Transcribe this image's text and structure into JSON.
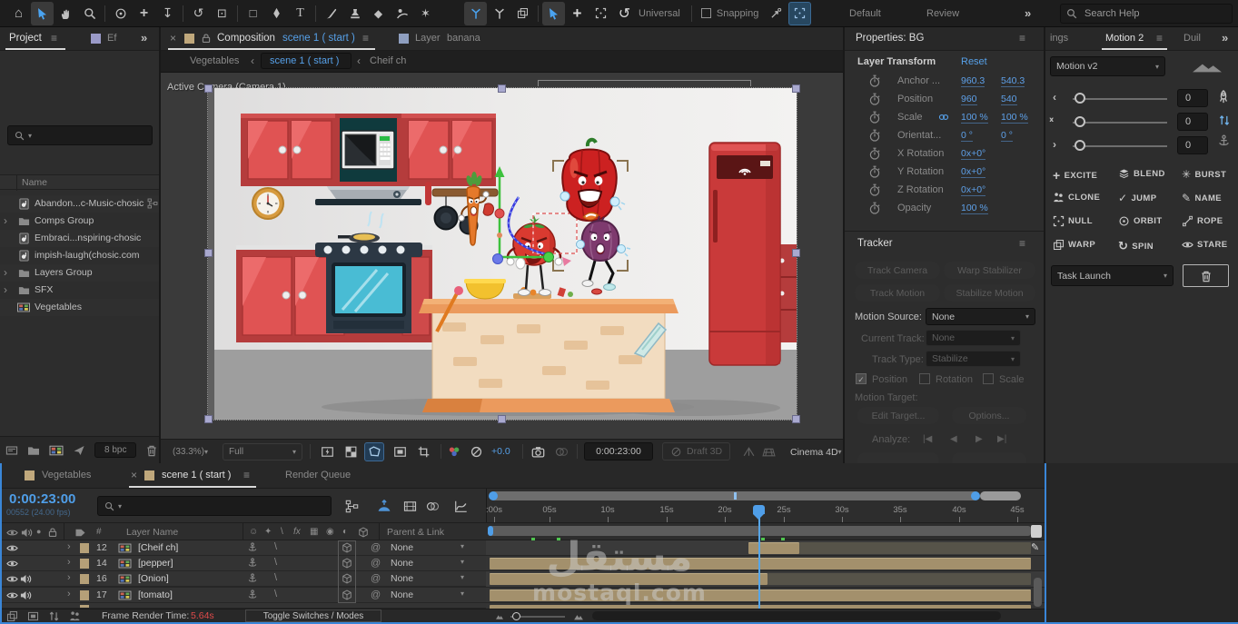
{
  "icons": {
    "hamburger": "≡",
    "more": "»",
    "close": "×",
    "caret": "▾",
    "back": "‹",
    "fwd": "›",
    "home": "⌂",
    "rot_ccw": "↺",
    "rot_cw": "↻",
    "plus": "+",
    "dolly": "↧",
    "text_tool": "T",
    "pen": "✎",
    "eraser": "◆",
    "rect_tool": "□",
    "roi_tool": "⊡",
    "pin": "✶",
    "pickwhip": "@",
    "solo": "●",
    "hash": "#",
    "star": "✦",
    "slash": "\\",
    "fx": "fx",
    "fgrid": "▦",
    "mblur": "◉",
    "adj": "◐",
    "shy": "☺",
    "s_in": "‹",
    "s_mid": "›‹",
    "s_out": "›",
    "t_first": "|◀",
    "t_prev": "◀",
    "t_play": "▶",
    "t_next": "▶|",
    "excite": "+",
    "burst": "✳",
    "jump": "✓",
    "name_pencil": "✎",
    "spin": "↻",
    "orbit": "◉",
    "stare": "◎"
  },
  "topbar": {
    "universal": "Universal",
    "snapping": "Snapping",
    "workspace_default": "Default",
    "workspace_review": "Review",
    "search_placeholder": "Search Help"
  },
  "project": {
    "tab_label": "Project",
    "effects_tab_label": "Ef",
    "name_header": "Name",
    "items": [
      {
        "name": "Abandon...c-Music-chosic",
        "type": "audio"
      },
      {
        "name": "Comps Group",
        "type": "folder"
      },
      {
        "name": "Embraci...nspiring-chosic",
        "type": "audio"
      },
      {
        "name": "impish-laugh(chosic.com",
        "type": "audio"
      },
      {
        "name": "Layers Group",
        "type": "folder"
      },
      {
        "name": "SFX",
        "type": "folder"
      },
      {
        "name": "Vegetables",
        "type": "comp"
      }
    ],
    "bpc_label": "8 bpc"
  },
  "composition": {
    "tab_prefix": "Composition",
    "tab_name": "scene 1 ( start )",
    "layer_tab_prefix": "Layer",
    "layer_tab_name": "banana",
    "crumb_root": "Vegetables",
    "crumb_current": "scene 1 ( start )",
    "crumb_next": "Cheif ch",
    "view_label": "Active Camera (Camera 1)",
    "zoom": "(33.3%)",
    "resolution": "Full",
    "exposure": "+0.0",
    "timecode": "0:00:23:00",
    "draft3d_label": "Draft 3D",
    "renderer": "Cinema 4D"
  },
  "properties": {
    "title": "Properties: BG",
    "transform_title": "Layer Transform",
    "reset": "Reset",
    "rows": [
      {
        "label": "Anchor ...",
        "v1": "960.3",
        "v2": "540.3"
      },
      {
        "label": "Position",
        "v1": "960",
        "v2": "540"
      },
      {
        "label": "Scale",
        "v1": "100 %",
        "v2": "100 %"
      },
      {
        "label": "Orientat...",
        "v1": "0 °",
        "v2": "0 °"
      },
      {
        "label": "X Rotation",
        "v1": "0x+0°",
        "v2": ""
      },
      {
        "label": "Y Rotation",
        "v1": "0x+0°",
        "v2": ""
      },
      {
        "label": "Z Rotation",
        "v1": "0x+0°",
        "v2": ""
      },
      {
        "label": "Opacity",
        "v1": "100 %",
        "v2": ""
      }
    ]
  },
  "tracker": {
    "title": "Tracker",
    "track_camera": "Track Camera",
    "warp_stabilizer": "Warp Stabilizer",
    "track_motion": "Track Motion",
    "stabilize_motion": "Stabilize Motion",
    "motion_source_label": "Motion Source:",
    "motion_source_value": "None",
    "current_track_label": "Current Track:",
    "current_track_value": "None",
    "track_type_label": "Track Type:",
    "track_type_value": "Stabilize",
    "cb_position": "Position",
    "cb_rotation": "Rotation",
    "cb_scale": "Scale",
    "motion_target_label": "Motion Target:",
    "edit_target": "Edit Target...",
    "options": "Options...",
    "analyze_label": "Analyze:"
  },
  "motion": {
    "tab_left": "ings",
    "tab_active": "Motion 2",
    "tab_right": "Duil",
    "preset": "Motion v2",
    "slider1": "0",
    "slider2": "0",
    "slider3": "0",
    "buttons": [
      "EXCITE",
      "BLEND",
      "BURST",
      "CLONE",
      "JUMP",
      "NAME",
      "NULL",
      "ORBIT",
      "ROPE",
      "WARP",
      "SPIN",
      "STARE"
    ],
    "task_launch": "Task Launch"
  },
  "timeline": {
    "tab_vegetables": "Vegetables",
    "tab_scene": "scene 1 ( start )",
    "tab_render_queue": "Render Queue",
    "timecode": "0:00:23:00",
    "frame_info": "00552 (24.00 fps)",
    "col_layer_name": "Layer Name",
    "col_parent": "Parent & Link",
    "rows": [
      {
        "num": "12",
        "name": "[Cheif ch]",
        "parent": "None"
      },
      {
        "num": "14",
        "name": "[pepper]",
        "parent": "None"
      },
      {
        "num": "16",
        "name": "[Onion]",
        "parent": "None"
      },
      {
        "num": "17",
        "name": "[tomato]",
        "parent": "None"
      }
    ],
    "ruler_ticks": [
      ":00s",
      "05s",
      "10s",
      "15s",
      "20s",
      "25s",
      "30s",
      "35s",
      "40s",
      "45s"
    ],
    "frame_render_label": "Frame Render Time:",
    "frame_render_value": "5.64s",
    "toggle_label": "Toggle Switches / Modes"
  },
  "watermark": {
    "line1": "مستقل",
    "line2": "mostaql.com"
  }
}
